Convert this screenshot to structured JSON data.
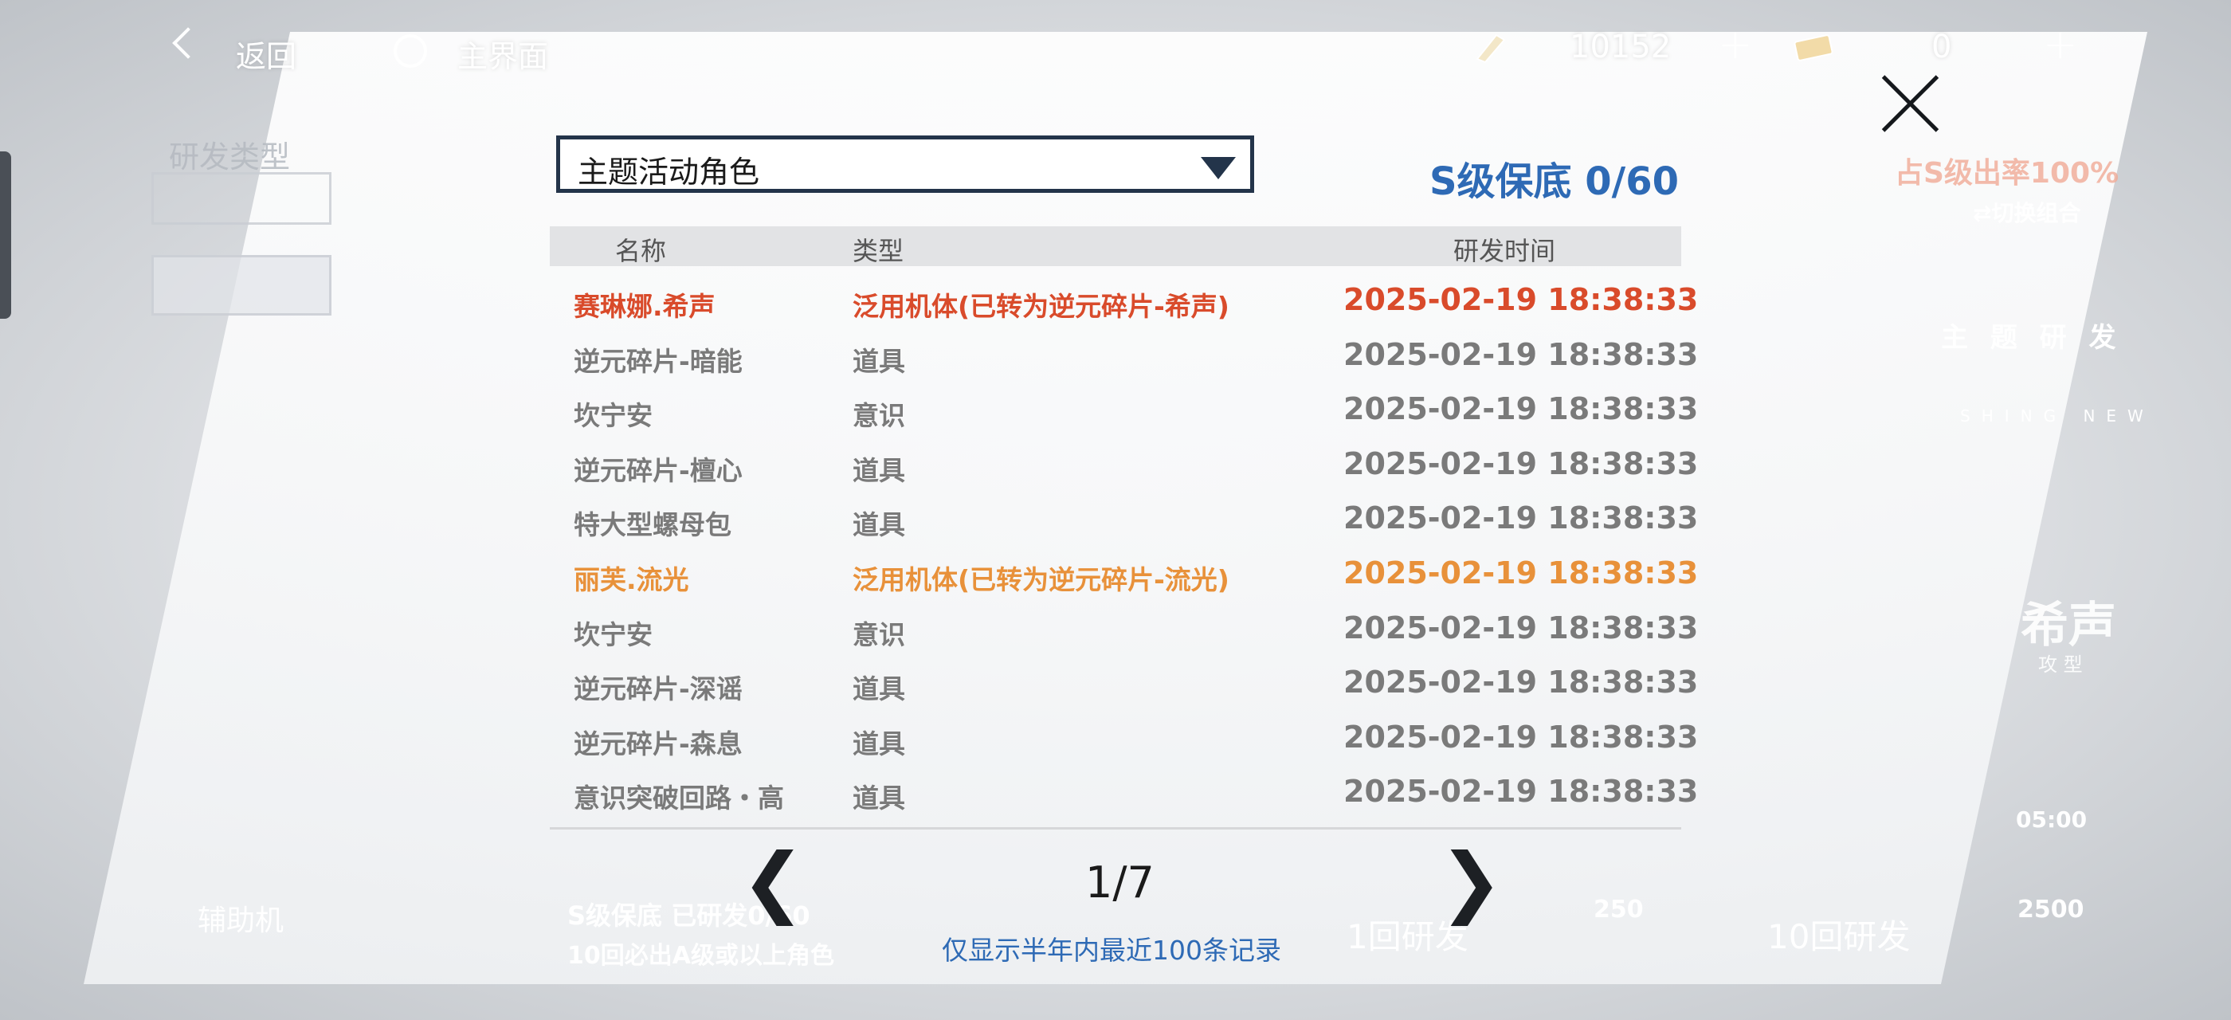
{
  "topbar": {
    "back_label": "返回",
    "home_label": "主界面",
    "currency1_value": "10152",
    "currency2_value": "0",
    "plus": "+"
  },
  "background": {
    "research_type": "研发类型",
    "s_rate": "占S级出率100%",
    "switch_combo": "⇄切换组合",
    "theme_research": "主 题 研 发",
    "new_tag": "SHING NEW",
    "hero_name": "希声",
    "hero_class": "攻 型",
    "support": "辅助机",
    "pity_bottom": "S级保底 已研发0/60",
    "guarantee": "10回必出A级或以上角色",
    "one_draw": "1回研发",
    "ten_draw": "10回研发",
    "cost_one": "250",
    "cost_ten": "2500",
    "time_label": "05:00"
  },
  "dialog": {
    "dropdown_value": "主题活动角色",
    "pity": "S级保底 0/60",
    "headers": {
      "name": "名称",
      "type": "类型",
      "time": "研发时间"
    },
    "rows": [
      {
        "name": "赛琳娜.希声",
        "type": "泛用机体(已转为逆元碎片-希声)",
        "time": "2025-02-19 18:38:33"
      },
      {
        "name": "逆元碎片-暗能",
        "type": "道具",
        "time": "2025-02-19 18:38:33"
      },
      {
        "name": "坎宁安",
        "type": "意识",
        "time": "2025-02-19 18:38:33"
      },
      {
        "name": "逆元碎片-檀心",
        "type": "道具",
        "time": "2025-02-19 18:38:33"
      },
      {
        "name": "特大型螺母包",
        "type": "道具",
        "time": "2025-02-19 18:38:33"
      },
      {
        "name": "丽芙.流光",
        "type": "泛用机体(已转为逆元碎片-流光)",
        "time": "2025-02-19 18:38:33"
      },
      {
        "name": "坎宁安",
        "type": "意识",
        "time": "2025-02-19 18:38:33"
      },
      {
        "name": "逆元碎片-深谣",
        "type": "道具",
        "time": "2025-02-19 18:38:33"
      },
      {
        "name": "逆元碎片-森息",
        "type": "道具",
        "time": "2025-02-19 18:38:33"
      },
      {
        "name": "意识突破回路・高",
        "type": "道具",
        "time": "2025-02-19 18:38:33"
      }
    ],
    "page": "1/7",
    "prev": "❮",
    "next": "❯",
    "note": "仅显示半年内最近100条记录"
  },
  "colors": {
    "accent_blue": "#2e6ab5",
    "s_rank": "#d94b2b",
    "a_rank": "#e8913a",
    "normal": "#7a7a7a"
  }
}
